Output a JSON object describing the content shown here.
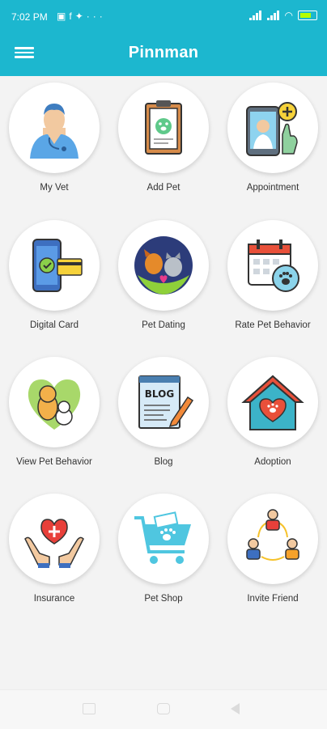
{
  "status_bar": {
    "time": "7:02 PM",
    "notification_icons": [
      "message-icon",
      "facebook-icon",
      "twitter-icon",
      "more-icon"
    ],
    "more": "···",
    "battery_color": "#b6ff00"
  },
  "header": {
    "title": "Pinnman",
    "menu_icon": "hamburger-icon",
    "color": "#1cb7cf"
  },
  "menu": {
    "items": [
      {
        "label": "My Vet",
        "icon": "vet-doctor-icon"
      },
      {
        "label": "Add Pet",
        "icon": "clipboard-paw-icon"
      },
      {
        "label": "Appointment",
        "icon": "video-call-doctor-icon"
      },
      {
        "label": "Digital Card",
        "icon": "phone-card-icon"
      },
      {
        "label": "Pet Dating",
        "icon": "dog-cat-heart-icon"
      },
      {
        "label": "Rate Pet Behavior",
        "icon": "calendar-paw-icon"
      },
      {
        "label": "View Pet Behavior",
        "icon": "dog-cat-heart-bg-icon"
      },
      {
        "label": "Blog",
        "icon": "blog-pencil-icon"
      },
      {
        "label": "Adoption",
        "icon": "house-paw-icon"
      },
      {
        "label": "Insurance",
        "icon": "hands-heart-icon"
      },
      {
        "label": "Pet Shop",
        "icon": "shopping-cart-paw-icon"
      },
      {
        "label": "Invite Friend",
        "icon": "invite-people-icon"
      }
    ]
  },
  "system_nav": {
    "icons": [
      "recent-apps-icon",
      "home-icon",
      "back-icon"
    ]
  }
}
